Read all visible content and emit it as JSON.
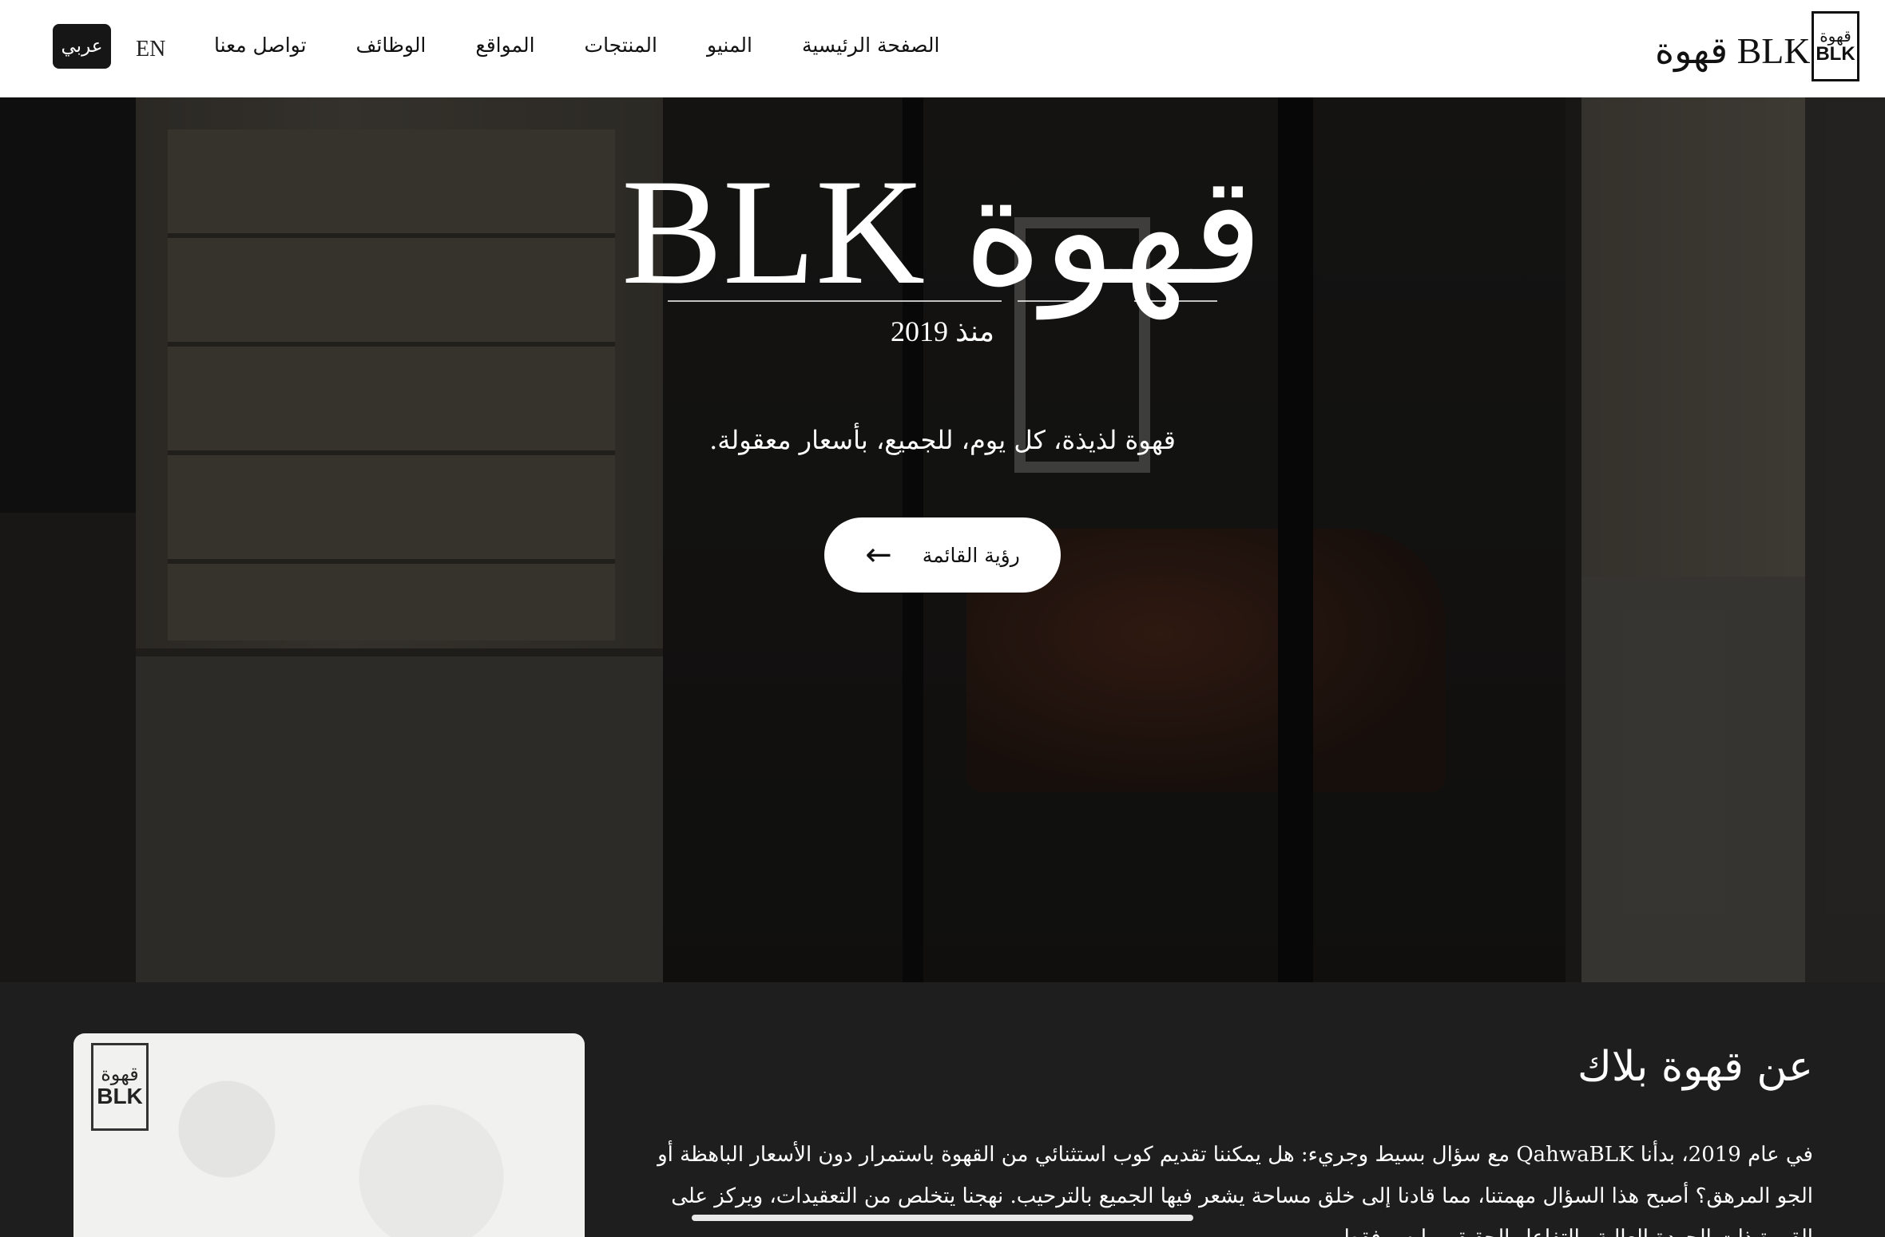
{
  "nav": {
    "lang_active": "عربي",
    "lang_other": "EN",
    "links": [
      "تواصل معنا",
      "الوظائف",
      "المواقع",
      "المنتجات",
      "المنيو",
      "الصفحة الرئيسية"
    ],
    "brand_text": "قهوة BLK",
    "logo_ar": "قهوة",
    "logo_en": "BLK"
  },
  "hero": {
    "title": "قهوة BLK",
    "since": "منذ 2019",
    "tagline": "قهوة لذيذة، كل يوم، للجميع، بأسعار معقولة.",
    "button_label": "رؤية القائمة",
    "button_icon": "arrow-left-icon"
  },
  "about": {
    "title": "عن قهوة بلاك",
    "card_logo_ar": "قهوة",
    "card_logo_en": "BLK",
    "text": "في عام 2019، بدأنا QahwaBLK مع سؤال بسيط وجريء: هل يمكننا تقديم كوب استثنائي من القهوة باستمرار دون الأسعار الباهظة أو الجو المرهق؟ أصبح هذا السؤال مهمتنا، مما قادنا إلى خلق مساحة يشعر فيها الجميع بالترحيب. نهجنا يتخلص من التعقيدات، ويركز على القهوة ذات الجودة العالية والتفاعل الحقيقي. ليس فقط"
  },
  "colors": {
    "nav_bg": "#ffffff",
    "dark_bg": "#1e1e1e",
    "lang_active_bg": "#161616"
  }
}
